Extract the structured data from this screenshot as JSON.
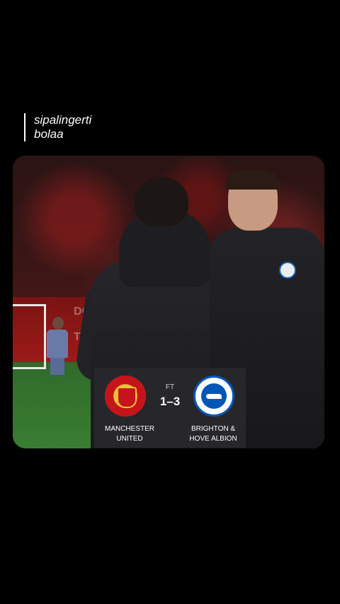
{
  "overlay": {
    "caption": "sipalingerti\nbolaa"
  },
  "scoreboard": {
    "status": "FT",
    "score": "1–3",
    "home": {
      "name_line1": "MANCHESTER",
      "name_line2": "UNITED",
      "crest": "manchester-united-crest-icon"
    },
    "away": {
      "name_line1": "BRIGHTON &",
      "name_line2": "HOVE ALBION",
      "crest": "brighton-crest-icon"
    }
  },
  "stadium": {
    "ad_texts": [
      "DOWN",
      "THE"
    ]
  },
  "colors": {
    "home": "#c7141a",
    "away": "#0057b8",
    "background": "#000000"
  }
}
